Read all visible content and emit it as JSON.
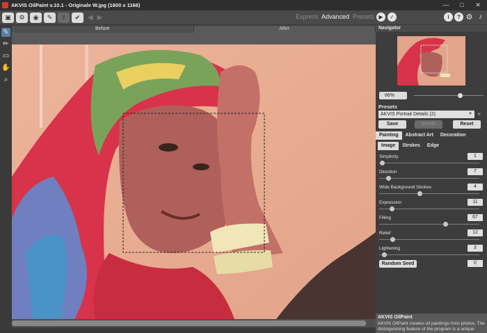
{
  "window": {
    "title": "AKVIS OilPaint v.10.1 - Originale W.jpg (1600 x 1166)",
    "controls": [
      "—",
      "□",
      "✕"
    ]
  },
  "toolbar": {
    "modes": [
      "Express",
      "Advanced",
      "Presets"
    ],
    "active_mode": "Advanced"
  },
  "canvas_tabs": {
    "before": "Before",
    "after": "After"
  },
  "navigator": {
    "title": "Navigator",
    "zoom": "66%",
    "zoom_fraction": 0.66
  },
  "presets": {
    "title": "Presets",
    "selected": "AKVIS Portrait Details (2)",
    "save_label": "Save",
    "delete_label": "Delete",
    "reset_label": "Reset"
  },
  "tabs": {
    "main": [
      "Painting",
      "Abstract Art",
      "Decoration"
    ],
    "sub": [
      "Image",
      "Strokes",
      "Edge"
    ]
  },
  "params": [
    {
      "label": "Simplicity",
      "value": "1",
      "max": 100
    },
    {
      "label": "Direction",
      "value": "7",
      "max": 100
    },
    {
      "label": "Wide Background Strokes",
      "value": "4",
      "max": 10
    },
    {
      "label": "Expression",
      "value": "11",
      "max": 100
    },
    {
      "label": "Filling",
      "value": "67",
      "max": 100
    },
    {
      "label": "Relief",
      "value": "12",
      "max": 100
    },
    {
      "label": "Lightening",
      "value": "3",
      "max": 100
    }
  ],
  "seed": {
    "label": "Random Seed",
    "value": "0"
  },
  "about": {
    "title": "AKVIS OilPaint",
    "text": "AKVIS OilPaint creates oil paintings from photos. The distinguishing feature of the program is a unique"
  },
  "colors": {
    "accent_blue": "#5b7ea8",
    "panel": "#3d3d3d",
    "scarf_red": "#d8334a",
    "skin": "#b0605a"
  }
}
